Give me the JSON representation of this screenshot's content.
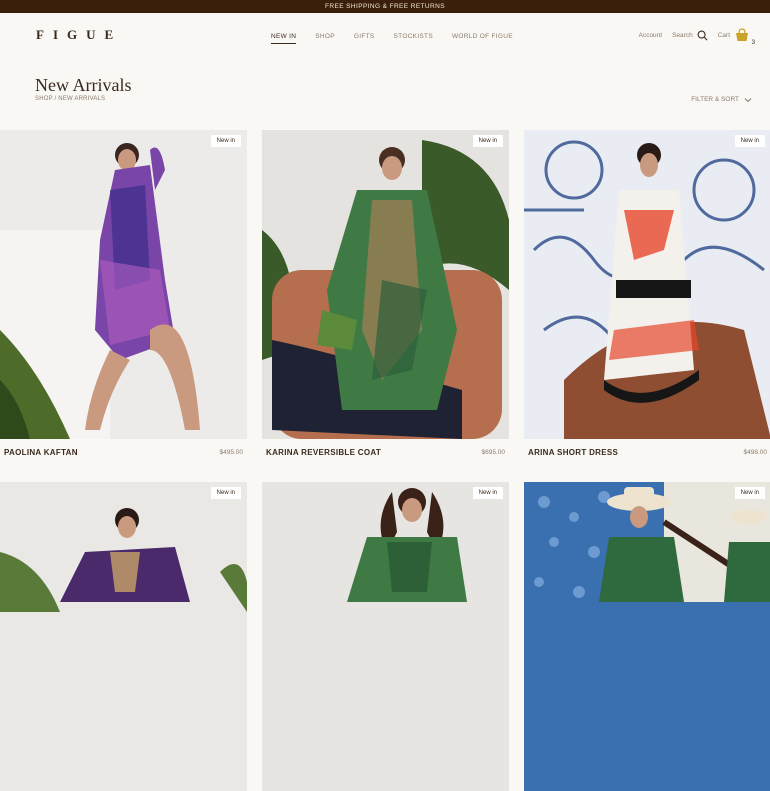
{
  "promo": {
    "text": "FREE SHIPPING & FREE RETURNS"
  },
  "header": {
    "logo": "FIGUE",
    "nav": [
      "NEW IN",
      "SHOP",
      "GIFTS",
      "STOCKISTS",
      "WORLD OF FIGUE"
    ],
    "account": "Account",
    "search": "Search",
    "cart": "Cart",
    "cart_count": "3"
  },
  "page": {
    "title": "New Arrivals",
    "breadcrumb": "SHOP / NEW ARRIVALS",
    "filter": "FILTER & SORT"
  },
  "products": [
    {
      "badge": "New in",
      "name": "PAOLINA KAFTAN",
      "price": "$495.00"
    },
    {
      "badge": "New in",
      "name": "KARINA REVERSIBLE COAT",
      "price": "$695.00"
    },
    {
      "badge": "New in",
      "name": "ARINA SHORT DRESS",
      "price": "$498.00"
    },
    {
      "badge": "New in",
      "name": "",
      "price": ""
    },
    {
      "badge": "New in",
      "name": "",
      "price": ""
    },
    {
      "badge": "New in",
      "name": "",
      "price": ""
    }
  ],
  "colors": {
    "promo_bg": "#3a1f0b",
    "text": "#3a2a1e",
    "muted": "#8a7a6a",
    "page_bg": "#faf8f5"
  }
}
